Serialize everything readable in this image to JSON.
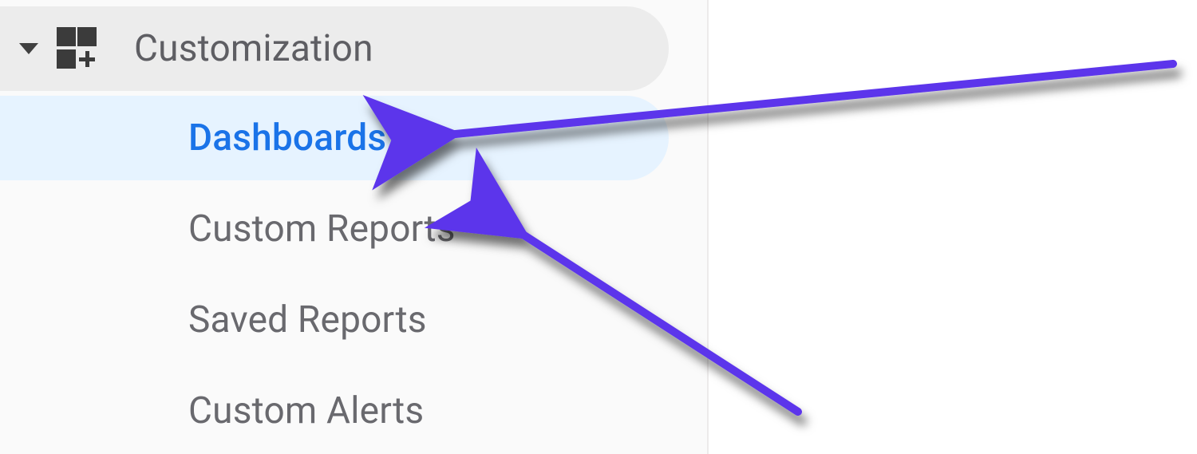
{
  "sidebar": {
    "section_label": "Customization",
    "items": [
      {
        "label": "Dashboards",
        "active": true
      },
      {
        "label": "Custom Reports",
        "active": false
      },
      {
        "label": "Saved Reports",
        "active": false
      },
      {
        "label": "Custom Alerts",
        "active": false
      }
    ]
  },
  "annotation": {
    "arrow_color": "#5b34eb"
  }
}
